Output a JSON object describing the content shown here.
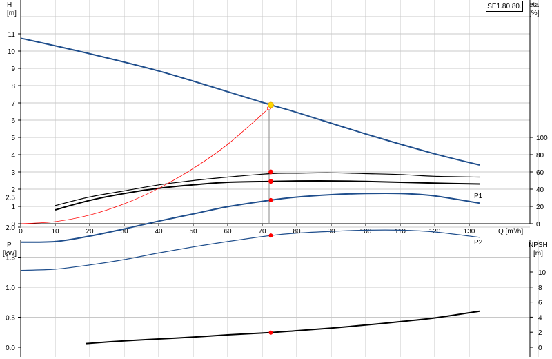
{
  "model": "SE1.80.80.",
  "colors": {
    "blue": "#1f4e8c",
    "red": "#ff0000",
    "black": "#000000",
    "grid": "#c8c8c8",
    "marker": "#ffd700"
  },
  "chart_data": [
    {
      "type": "line",
      "y_left_label": "H",
      "y_left_unit": "[m]",
      "y_right_label": "eta",
      "y_right_unit": "[%]",
      "x_label": "Q [m³/h]",
      "xlim": [
        0,
        140
      ],
      "ylim_left": [
        0,
        12
      ],
      "ylim_right": [
        0,
        100
      ],
      "x_ticks": [
        0,
        10,
        20,
        30,
        40,
        50,
        60,
        70,
        80,
        90,
        100,
        110,
        120,
        130
      ],
      "y_left_ticks": [
        0,
        1,
        2,
        3,
        4,
        5,
        6,
        7,
        8,
        9,
        10,
        11
      ],
      "y_right_ticks": [
        0,
        20,
        40,
        60,
        80,
        100
      ],
      "duty_point": {
        "q": 72,
        "h": 6.7
      },
      "series": [
        {
          "type": "curve",
          "axis": "left",
          "color": "#1f4e8c",
          "x": [
            0,
            20,
            40,
            60,
            72.5,
            80,
            100,
            120,
            133
          ],
          "y": [
            10.75,
            9.85,
            8.85,
            7.65,
            6.88,
            6.45,
            5.2,
            4.05,
            3.4
          ]
        },
        {
          "type": "curve",
          "axis": "right",
          "color": "#000000",
          "x": [
            10,
            20,
            30,
            40,
            50,
            60,
            72.5,
            80,
            90,
            100,
            110,
            120,
            133
          ],
          "y": [
            21,
            31,
            38,
            45,
            50,
            54,
            58,
            58.5,
            59,
            58,
            57,
            55,
            54
          ]
        },
        {
          "type": "curve",
          "axis": "right",
          "color": "#000000",
          "x": [
            10,
            20,
            30,
            40,
            50,
            60,
            72.5,
            80,
            90,
            100,
            110,
            120,
            133
          ],
          "y": [
            16,
            27,
            35,
            41,
            45,
            48,
            49,
            49.5,
            49.5,
            49,
            48,
            47,
            46
          ]
        },
        {
          "type": "curve",
          "axis": "left",
          "color": "#ff0000",
          "x": [
            0,
            10,
            20,
            30,
            40,
            50,
            60,
            72
          ],
          "y": [
            0,
            0.12,
            0.5,
            1.15,
            2.05,
            3.2,
            4.6,
            6.7
          ]
        }
      ],
      "points": [
        {
          "x": 72.5,
          "y": 6.88,
          "axis": "left",
          "color": "#ffd700"
        },
        {
          "x": 72.5,
          "y": 60,
          "axis": "right",
          "color": "#ff0000"
        },
        {
          "x": 72.5,
          "y": 49,
          "axis": "right",
          "color": "#ff0000"
        }
      ]
    },
    {
      "type": "line",
      "y_left_label": "P",
      "y_left_unit": "[kW]",
      "y_right_label": "NPSH",
      "y_right_unit": "[m]",
      "xlim": [
        0,
        140
      ],
      "ylim_left": [
        0,
        3.0
      ],
      "ylim_right": [
        0,
        12
      ],
      "y_left_ticks": [
        0,
        0.5,
        1.0,
        1.5,
        2.0,
        2.5
      ],
      "y_left_tick_labels": [
        "0.0",
        "0.5",
        "1.0",
        "1.5",
        "2.0",
        "2.5"
      ],
      "y_right_ticks": [
        0,
        2,
        4,
        6,
        8,
        10
      ],
      "series": [
        {
          "name": "P1",
          "type": "curve",
          "axis": "left",
          "color": "#1f4e8c",
          "x": [
            0,
            10,
            20,
            30,
            40,
            50,
            60,
            72.5,
            80,
            90,
            100,
            110,
            120,
            133
          ],
          "y": [
            1.75,
            1.76,
            1.85,
            1.97,
            2.1,
            2.22,
            2.34,
            2.45,
            2.5,
            2.54,
            2.56,
            2.56,
            2.52,
            2.4
          ]
        },
        {
          "name": "P2",
          "type": "curve",
          "axis": "left",
          "color": "#1f4e8c",
          "x": [
            0,
            10,
            20,
            30,
            40,
            50,
            60,
            72.5,
            80,
            90,
            100,
            110,
            120,
            133
          ],
          "y": [
            1.28,
            1.3,
            1.37,
            1.46,
            1.57,
            1.67,
            1.76,
            1.86,
            1.9,
            1.93,
            1.95,
            1.95,
            1.92,
            1.83
          ]
        },
        {
          "type": "curve",
          "axis": "right",
          "color": "#000000",
          "x": [
            19,
            30,
            40,
            50,
            60,
            72.5,
            80,
            90,
            100,
            110,
            120,
            133
          ],
          "y": [
            0.5,
            0.85,
            1.1,
            1.35,
            1.65,
            1.95,
            2.2,
            2.55,
            2.95,
            3.4,
            3.9,
            4.8
          ]
        }
      ],
      "points": [
        {
          "x": 72.5,
          "y": 2.45,
          "axis": "left",
          "color": "#ff0000"
        },
        {
          "x": 72.5,
          "y": 1.86,
          "axis": "left",
          "color": "#ff0000"
        },
        {
          "x": 72.5,
          "y": 1.95,
          "axis": "right",
          "color": "#ff0000"
        }
      ]
    }
  ]
}
